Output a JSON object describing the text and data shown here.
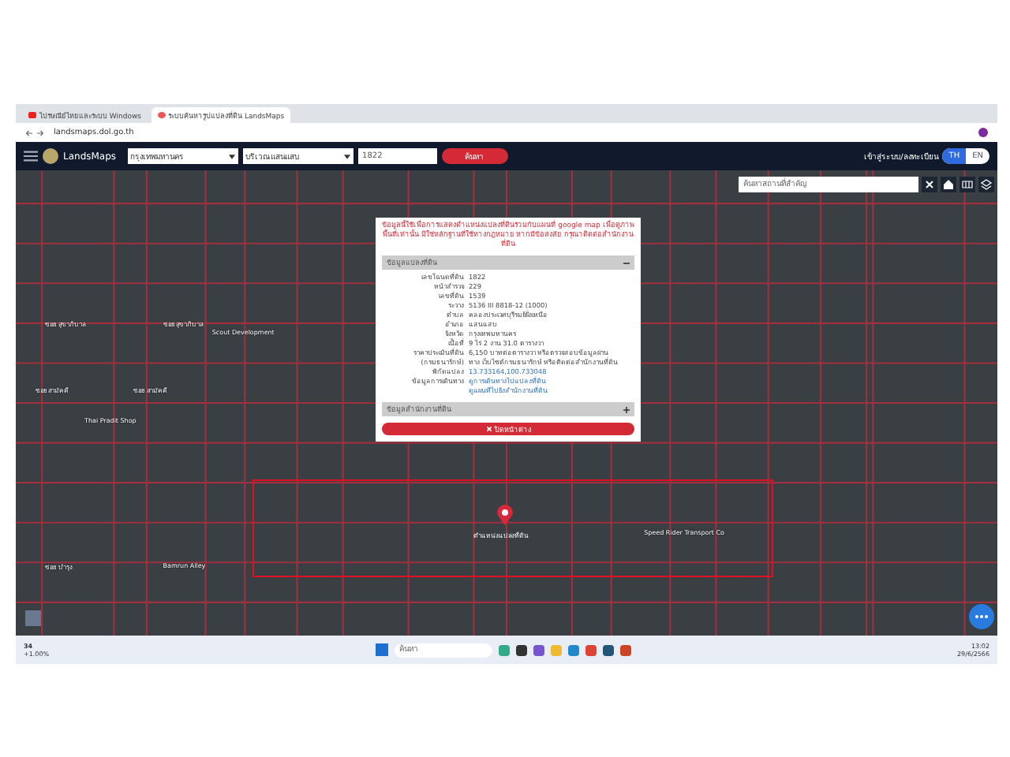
{
  "browser": {
    "tabs": [
      {
        "title": "ไปรษณีย์ไทยและระบบ Windows",
        "selected": false
      },
      {
        "title": "ระบบค้นหารูปแปลงที่ดิน LandsMaps",
        "selected": true
      }
    ],
    "url": "landsmaps.dol.go.th"
  },
  "header": {
    "logo": "LandsMaps",
    "province": "กรุงเทพมหานคร",
    "district": "บริเวณแสนแสบ",
    "parcel": "1822",
    "search_button": "ค้นหา",
    "login": "เข้าสู่ระบบ/ลงทะเบียน",
    "languages": [
      {
        "label": "TH",
        "selected": true
      },
      {
        "label": "EN",
        "selected": false
      }
    ]
  },
  "map": {
    "search": {
      "placeholder": "ค้นหาสถานที่สำคัญ"
    },
    "labels": [
      "ซอย สุขาภิบาล",
      "ซอย สุขาภิบาล",
      "Scout Development",
      "ซอย สามัคคี",
      "ซอย สามัคคี",
      "Thai Pradit Shop",
      "Speed Rider Transport Co",
      "ซอย บำรุง",
      "Bamrun Alley"
    ],
    "marker_label": "ตำแหน่งแปลงที่ดิน"
  },
  "popup": {
    "notice": "ข้อมูลนี้ใช้เพื่อการแสดงตำแหน่งแปลงที่ดินร่วมกับแผนที่ google map เพื่อดูภาพพื้นที่เท่านั้น มิใช่หลักฐานที่ใช้ทางกฎหมาย หากมีข้อสงสัย กรุณาติดต่อสำนักงานที่ดิน",
    "sections": [
      {
        "title": "ข้อมูลแปลงที่ดิน",
        "expanded": true,
        "rows": [
          {
            "label": "เลขโฉนดที่ดิน",
            "value": "1822",
            "kind": "text"
          },
          {
            "label": "หน้าสำรวจ",
            "value": "229",
            "kind": "text"
          },
          {
            "label": "เลขที่ดิน",
            "value": "1539",
            "kind": "text"
          },
          {
            "label": "ระวาง",
            "value": "5136 III 8818-12 (1000)",
            "kind": "text"
          },
          {
            "label": "ตำบล",
            "value": "คลองประเวศบุรีรมย์ฝั่งเหนือ",
            "kind": "text"
          },
          {
            "label": "อำเภอ",
            "value": "แสนแสบ",
            "kind": "text"
          },
          {
            "label": "จังหวัด",
            "value": "กรุงเทพมหานคร",
            "kind": "text"
          },
          {
            "label": "เนื้อที่",
            "value": "9 ไร่ 2 งาน 31.0 ตารางวา",
            "kind": "text"
          },
          {
            "label": "ราคาประเมินที่ดิน",
            "value": "6,150 บาทต่อตารางวา หรือตรวจสอบข้อมูลผ่าน",
            "kind": "text"
          },
          {
            "label": "(กรมธนารักษ์)",
            "value": "ทาง เว็บไซต์กรมธนารักษ์ หรือติดต่อสำนักงานที่ดิน",
            "kind": "text"
          },
          {
            "label": "พิกัดแปลง",
            "value": "13.733164,100.733048",
            "kind": "link"
          },
          {
            "label": "ข้อมูลการเดินทาง",
            "value": "ดูการเดินทางไปแปลงที่ดิน",
            "kind": "link"
          },
          {
            "label": "",
            "value": "ดูแผนที่ไปยังสำนักงานที่ดิน",
            "kind": "link"
          }
        ]
      },
      {
        "title": "ข้อมูลสำนักงานที่ดิน",
        "expanded": false
      }
    ],
    "close_button": "ปิดหน้าต่าง"
  },
  "taskbar": {
    "widget_value": "34",
    "widget_change": "+1.00%",
    "search": "ค้นหา",
    "time": "13:02",
    "date": "29/6/2566"
  }
}
